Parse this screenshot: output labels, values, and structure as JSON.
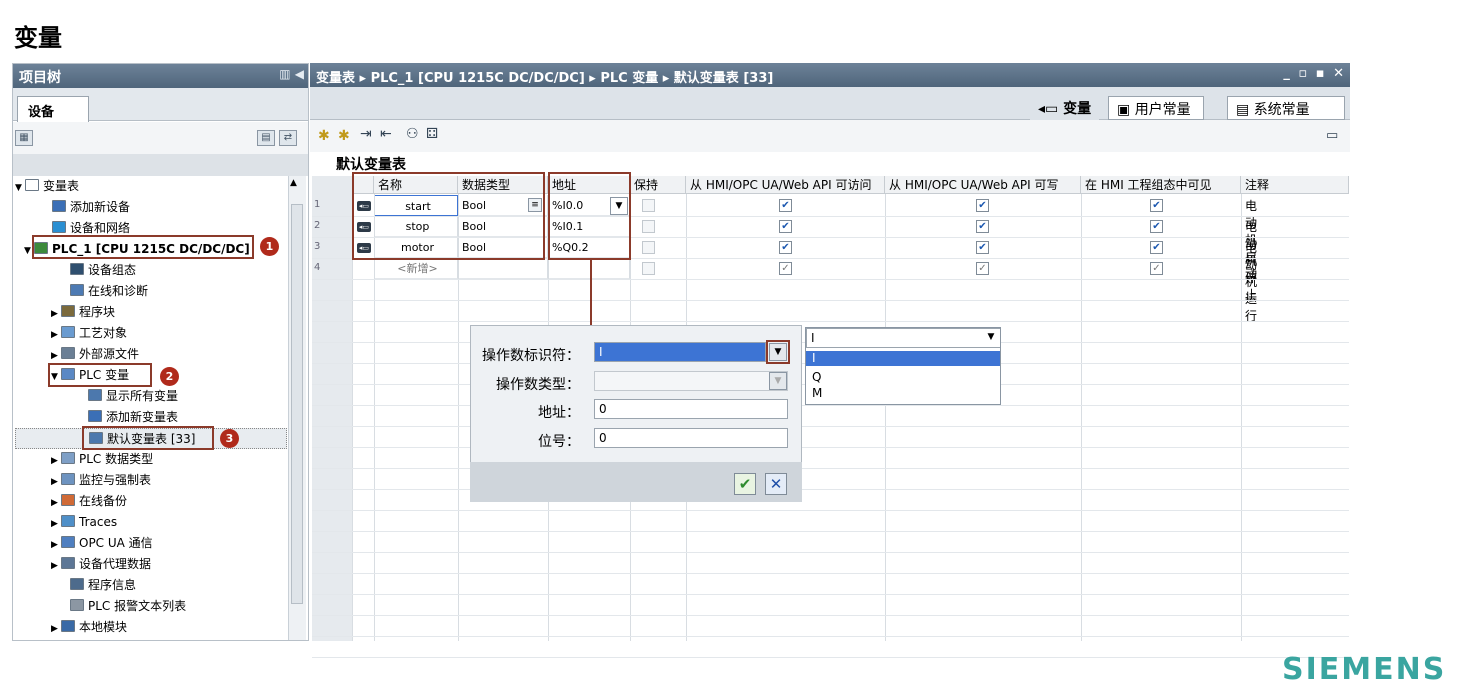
{
  "heading": "变量",
  "left": {
    "title": "项目树",
    "tab": "设备",
    "tree": [
      {
        "label": "变量表",
        "indent": 0,
        "arrow": "▼",
        "icon": "#ffffff",
        "id": "tree-var-table"
      },
      {
        "label": "添加新设备",
        "indent": 3,
        "arrow": "",
        "icon": "#3b6fb6",
        "id": "tree-add-device"
      },
      {
        "label": "设备和网络",
        "indent": 3,
        "arrow": "",
        "icon": "#2a8fd2",
        "id": "tree-devices-networks"
      },
      {
        "label": "PLC_1 [CPU 1215C DC/DC/DC]",
        "indent": 1,
        "arrow": "▼",
        "icon": "#3c8a3c",
        "id": "tree-plc1",
        "bold": true
      },
      {
        "label": "设备组态",
        "indent": 5,
        "arrow": "",
        "icon": "#2f4f6f",
        "id": "tree-device-config"
      },
      {
        "label": "在线和诊断",
        "indent": 5,
        "arrow": "",
        "icon": "#4d7ab3",
        "id": "tree-online-diag"
      },
      {
        "label": "程序块",
        "indent": 4,
        "arrow": "▶",
        "icon": "#7b6a3c",
        "id": "tree-program-blocks"
      },
      {
        "label": "工艺对象",
        "indent": 4,
        "arrow": "▶",
        "icon": "#6a9bd0",
        "id": "tree-tech-objects"
      },
      {
        "label": "外部源文件",
        "indent": 4,
        "arrow": "▶",
        "icon": "#6b7f95",
        "id": "tree-external-sources"
      },
      {
        "label": "PLC 变量",
        "indent": 4,
        "arrow": "▼",
        "icon": "#5a88c4",
        "id": "tree-plc-tags"
      },
      {
        "label": "显示所有变量",
        "indent": 7,
        "arrow": "",
        "icon": "#4c78ad",
        "id": "tree-show-all-tags"
      },
      {
        "label": "添加新变量表",
        "indent": 7,
        "arrow": "",
        "icon": "#3b6fb6",
        "id": "tree-add-tag-table"
      },
      {
        "label": "默认变量表 [33]",
        "indent": 7,
        "arrow": "",
        "icon": "#4c78ad",
        "id": "tree-default-tag-table"
      },
      {
        "label": "PLC 数据类型",
        "indent": 4,
        "arrow": "▶",
        "icon": "#7e9fc6",
        "id": "tree-plc-datatypes"
      },
      {
        "label": "监控与强制表",
        "indent": 4,
        "arrow": "▶",
        "icon": "#6d93c0",
        "id": "tree-watch-force"
      },
      {
        "label": "在线备份",
        "indent": 4,
        "arrow": "▶",
        "icon": "#d06a36",
        "id": "tree-online-backup"
      },
      {
        "label": "Traces",
        "indent": 4,
        "arrow": "▶",
        "icon": "#4f8fc8",
        "id": "tree-traces"
      },
      {
        "label": "OPC UA 通信",
        "indent": 4,
        "arrow": "▶",
        "icon": "#4f7fc0",
        "id": "tree-opc-ua"
      },
      {
        "label": "设备代理数据",
        "indent": 4,
        "arrow": "▶",
        "icon": "#5d7796",
        "id": "tree-device-proxy"
      },
      {
        "label": "程序信息",
        "indent": 5,
        "arrow": "",
        "icon": "#4d6b8c",
        "id": "tree-program-info"
      },
      {
        "label": "PLC 报警文本列表",
        "indent": 5,
        "arrow": "",
        "icon": "#8c97a3",
        "id": "tree-alarm-text"
      },
      {
        "label": "本地模块",
        "indent": 4,
        "arrow": "▶",
        "icon": "#3a6aa6",
        "id": "tree-local-modules"
      }
    ],
    "badges": [
      "1",
      "2",
      "3"
    ]
  },
  "editor": {
    "breadcrumb": "变量表 ▸ PLC_1 [CPU 1215C DC/DC/DC] ▸ PLC 变量 ▸ 默认变量表 [33]",
    "window_controls": "_ ▫ ▪ ✕",
    "tabs": {
      "tags": "变量",
      "user_constants": "用户常量",
      "system_constants": "系统常量"
    },
    "table_title": "默认变量表",
    "columns": [
      "名称",
      "数据类型",
      "地址",
      "保持",
      "从 HMI/OPC UA/Web API 可访问",
      "从 HMI/OPC UA/Web API 可写",
      "在 HMI 工程组态中可见",
      "注释"
    ],
    "rows": [
      {
        "num": "1",
        "name": "start",
        "type": "Bool",
        "address": "%I0.0",
        "comment": "电动机启动"
      },
      {
        "num": "2",
        "name": "stop",
        "type": "Bool",
        "address": "%I0.1",
        "comment": "电动机停止"
      },
      {
        "num": "3",
        "name": "motor",
        "type": "Bool",
        "address": "%Q0.2",
        "comment": "电动机运行"
      },
      {
        "num": "4",
        "name": "<新增>",
        "type": "",
        "address": "",
        "comment": ""
      }
    ]
  },
  "popup": {
    "operand_id_label": "操作数标识符：",
    "operand_id_value": "I",
    "operand_type_label": "操作数类型：",
    "operand_type_value": "",
    "address_label": "地址：",
    "address_value": "0",
    "bit_label": "位号：",
    "bit_value": "0",
    "dropdown": {
      "selected": "I",
      "options": [
        "I",
        "Q",
        "M"
      ]
    }
  },
  "brand": "SIEMENS",
  "colors": {
    "highlight": "#8b3a2a",
    "badge": "#b02a1b",
    "title_bar": "#5a6f85",
    "dd_selected": "#3d74d4"
  }
}
